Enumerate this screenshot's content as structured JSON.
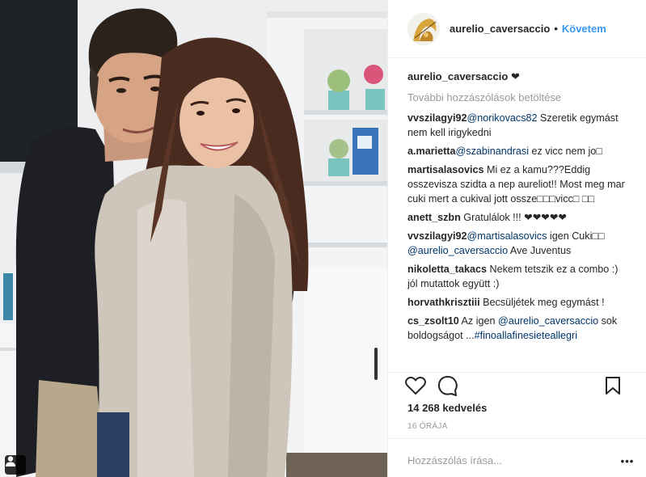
{
  "header": {
    "username": "aurelio_caversaccio",
    "separator": "•",
    "follow_label": "Követem"
  },
  "caption": {
    "username": "aurelio_caversaccio",
    "text": "❤"
  },
  "load_more": "További hozzászólások betöltése",
  "comments": [
    {
      "user": "vvszilagyi92",
      "parts": [
        {
          "t": "mention",
          "v": "@norikovacs82"
        },
        {
          "t": "text",
          "v": " Szeretik egymást nem kell irigykedni"
        }
      ]
    },
    {
      "user": "a.marietta",
      "parts": [
        {
          "t": "mention",
          "v": "@szabinandrasi"
        },
        {
          "t": "text",
          "v": " ez vicc nem jo□"
        }
      ]
    },
    {
      "user": "martisalasovics",
      "parts": [
        {
          "t": "text",
          "v": " Mi ez a kamu???Eddig osszevisza szidta a nep aureliot!! Most meg mar cuki mert a cukival jott ossze□□□vicc□ □□"
        }
      ]
    },
    {
      "user": "anett_szbn",
      "parts": [
        {
          "t": "text",
          "v": " Gratulálok !!! ❤❤❤❤❤"
        }
      ]
    },
    {
      "user": "vvszilagyi92",
      "parts": [
        {
          "t": "mention",
          "v": "@martisalasovics"
        },
        {
          "t": "text",
          "v": " igen Cuki□□ "
        },
        {
          "t": "mention",
          "v": "@aurelio_caversaccio"
        },
        {
          "t": "text",
          "v": " Ave Juventus"
        }
      ]
    },
    {
      "user": "nikoletta_takacs",
      "parts": [
        {
          "t": "text",
          "v": " Nekem tetszik ez a combo :) jól mutattok együtt :)"
        }
      ]
    },
    {
      "user": "horvathkrisztiii",
      "parts": [
        {
          "t": "text",
          "v": " Becsüljétek meg egymást !"
        }
      ]
    },
    {
      "user": "cs_zsolt10",
      "parts": [
        {
          "t": "text",
          "v": " Az igen "
        },
        {
          "t": "mention",
          "v": "@aurelio_caversaccio"
        },
        {
          "t": "text",
          "v": " sok boldogságot ..."
        },
        {
          "t": "mention",
          "v": "#finoallafinesieteallegri"
        }
      ]
    }
  ],
  "likes": "14 268 kedvelés",
  "time": "16 ÓRÁJA",
  "add_comment": {
    "placeholder": "Hozzászólás írása..."
  },
  "more_label": "•••",
  "icons": {
    "like": "heart-icon",
    "comment": "comment-bubble-icon",
    "save": "bookmark-icon",
    "tag": "user-tag-icon"
  },
  "colors": {
    "link": "#3897f0",
    "mention": "#003569",
    "muted": "#999999",
    "text": "#262626",
    "border": "#efefef"
  }
}
